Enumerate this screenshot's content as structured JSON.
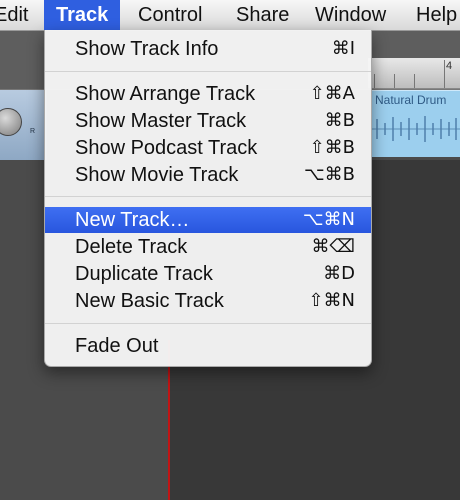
{
  "menubar": {
    "items": [
      {
        "label": "Edit"
      },
      {
        "label": "Track"
      },
      {
        "label": "Control"
      },
      {
        "label": "Share"
      },
      {
        "label": "Window"
      },
      {
        "label": "Help"
      }
    ],
    "active": "Track"
  },
  "background": {
    "ruler_number": "4",
    "track_header_label": "R",
    "region_name": "Natural Drum",
    "accent_color": "#2f5fe0",
    "playhead_color": "#c21414"
  },
  "menu": {
    "items": [
      {
        "label": "Show Track Info",
        "shortcut": "⌘I"
      },
      {
        "label": "Show Arrange Track",
        "shortcut": "⇧⌘A"
      },
      {
        "label": "Show Master Track",
        "shortcut": "⌘B"
      },
      {
        "label": "Show Podcast Track",
        "shortcut": "⇧⌘B"
      },
      {
        "label": "Show Movie Track",
        "shortcut": "⌥⌘B"
      },
      {
        "label": "New Track…",
        "shortcut": "⌥⌘N",
        "highlighted": true
      },
      {
        "label": "Delete Track",
        "shortcut": "⌘⌫"
      },
      {
        "label": "Duplicate Track",
        "shortcut": "⌘D"
      },
      {
        "label": "New Basic Track",
        "shortcut": "⇧⌘N"
      },
      {
        "label": "Fade Out",
        "shortcut": ""
      }
    ]
  }
}
